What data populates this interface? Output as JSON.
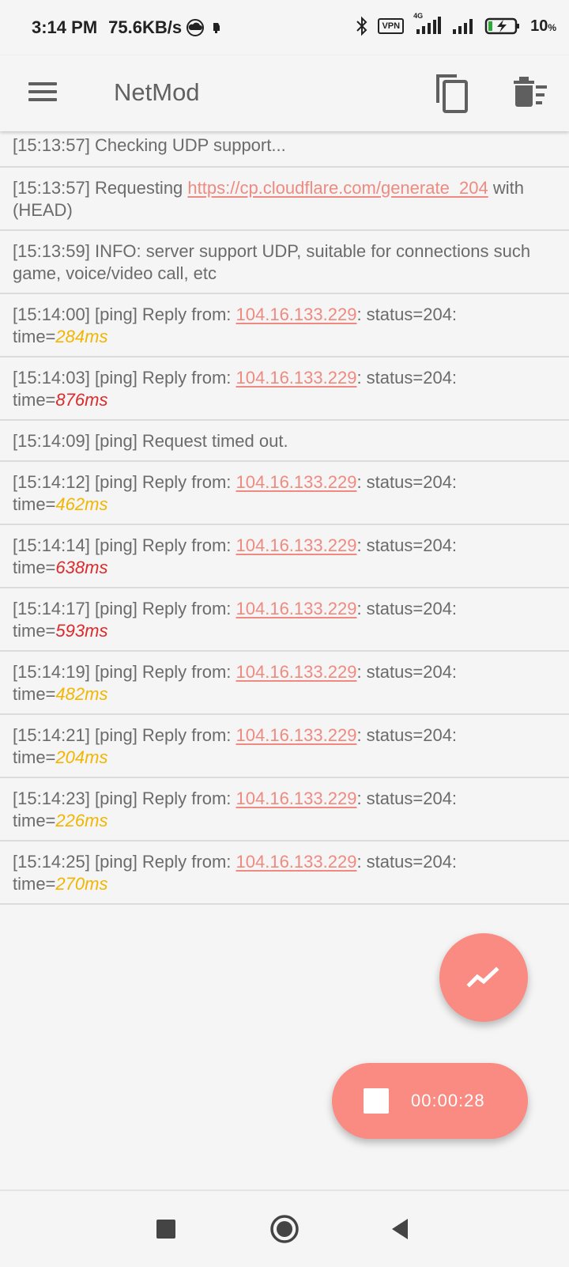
{
  "status_bar": {
    "time": "3:14 PM",
    "net_speed": "75.6KB/s",
    "vpn_label": "VPN",
    "network_type": "4G",
    "battery_value": "10",
    "battery_unit": "%"
  },
  "app_bar": {
    "title": "NetMod"
  },
  "log": [
    {
      "ts": "[15:13:57]",
      "text": " Checking UDP support..."
    },
    {
      "ts": "[15:13:57]",
      "text": " Requesting ",
      "link": "https://cp.cloudflare.com/generate_204",
      "text2": " with (HEAD)"
    },
    {
      "ts": "[15:13:59]",
      "text": " INFO: server support UDP, suitable for connections such game, voice/video call, etc"
    },
    {
      "ts": "[15:14:00]",
      "text": " [ping] Reply from: ",
      "link": "104.16.133.229",
      "text2": ": status=204: time=",
      "time": "284ms",
      "level": "warn"
    },
    {
      "ts": "[15:14:03]",
      "text": " [ping] Reply from: ",
      "link": "104.16.133.229",
      "text2": ": status=204: time=",
      "time": "876ms",
      "level": "bad"
    },
    {
      "ts": "[15:14:09]",
      "text": " [ping] Request timed out."
    },
    {
      "ts": "[15:14:12]",
      "text": " [ping] Reply from: ",
      "link": "104.16.133.229",
      "text2": ": status=204: time=",
      "time": "462ms",
      "level": "warn"
    },
    {
      "ts": "[15:14:14]",
      "text": " [ping] Reply from: ",
      "link": "104.16.133.229",
      "text2": ": status=204: time=",
      "time": "638ms",
      "level": "bad"
    },
    {
      "ts": "[15:14:17]",
      "text": " [ping] Reply from: ",
      "link": "104.16.133.229",
      "text2": ": status=204: time=",
      "time": "593ms",
      "level": "bad"
    },
    {
      "ts": "[15:14:19]",
      "text": " [ping] Reply from: ",
      "link": "104.16.133.229",
      "text2": ": status=204: time=",
      "time": "482ms",
      "level": "warn"
    },
    {
      "ts": "[15:14:21]",
      "text": " [ping] Reply from: ",
      "link": "104.16.133.229",
      "text2": ": status=204: time=",
      "time": "204ms",
      "level": "warn"
    },
    {
      "ts": "[15:14:23]",
      "text": " [ping] Reply from: ",
      "link": "104.16.133.229",
      "text2": ": status=204: time=",
      "time": "226ms",
      "level": "warn"
    },
    {
      "ts": "[15:14:25]",
      "text": " [ping] Reply from: ",
      "link": "104.16.133.229",
      "text2": ": status=204: time=",
      "time": "270ms",
      "level": "warn"
    }
  ],
  "fab": {
    "graph_icon": "trending-up-icon",
    "stop_icon": "stop-icon",
    "timer": "00:00:28"
  },
  "nav_bar": {
    "items": [
      "recents-square-icon",
      "home-circle-icon",
      "back-triangle-icon"
    ]
  },
  "colors": {
    "accent": "#f98b82",
    "link": "#ef8a80",
    "time_warn": "#f2b600",
    "time_bad": "#dd2a2a"
  }
}
